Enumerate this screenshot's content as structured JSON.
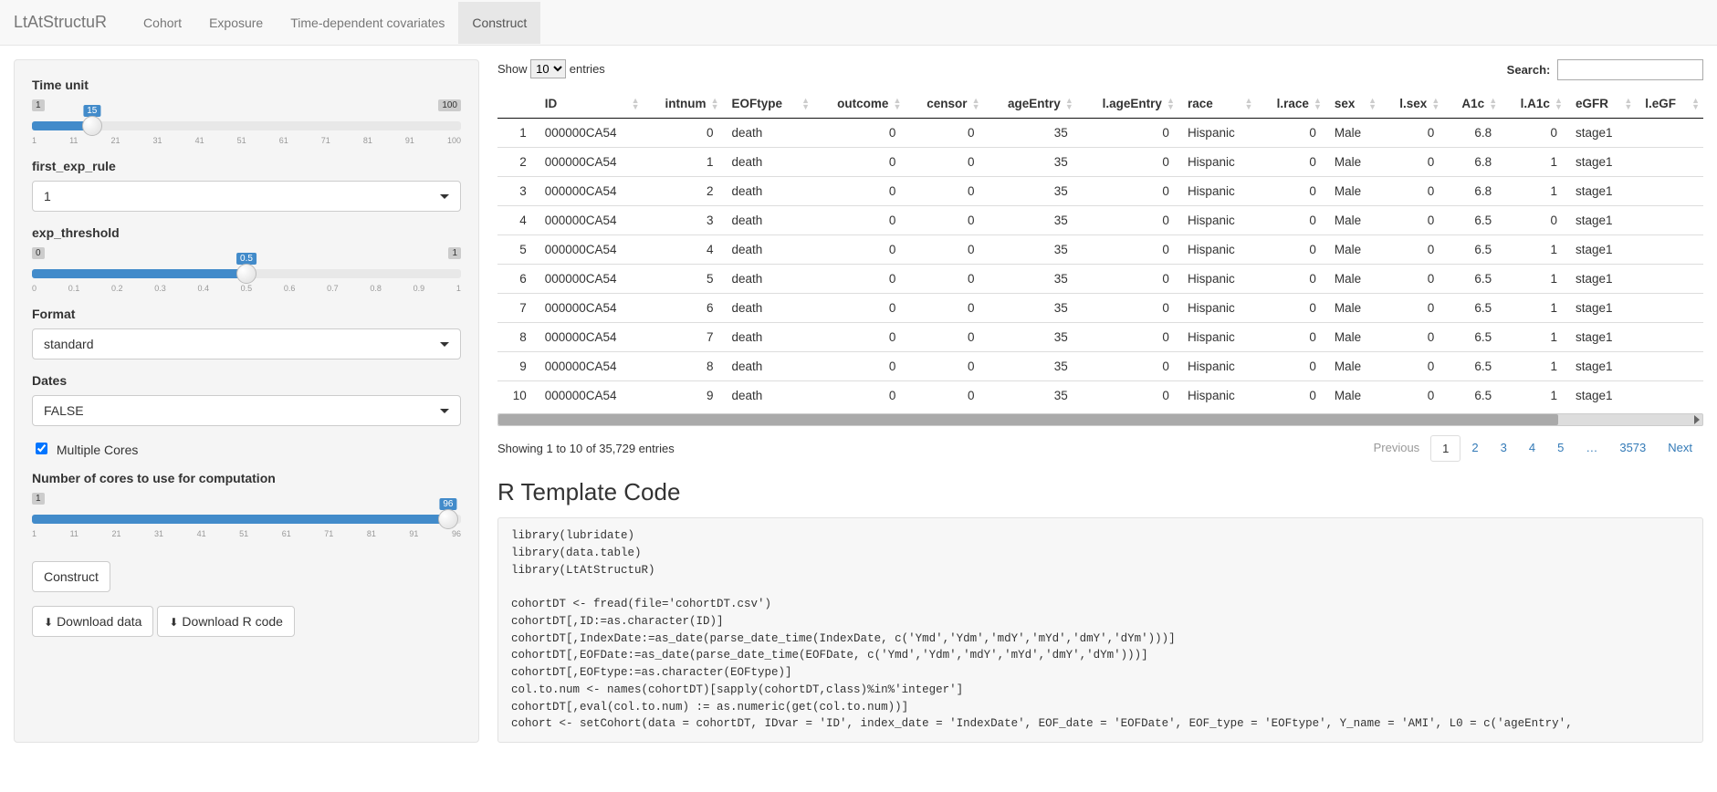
{
  "app": {
    "brand": "LtAtStructuR"
  },
  "nav": {
    "items": [
      {
        "label": "Cohort",
        "active": false
      },
      {
        "label": "Exposure",
        "active": false
      },
      {
        "label": "Time-dependent covariates",
        "active": false
      },
      {
        "label": "Construct",
        "active": true
      }
    ]
  },
  "sidebar": {
    "time_unit": {
      "label": "Time unit",
      "min": "1",
      "max": "100",
      "value": "15",
      "pct": 14,
      "ticks": [
        "1",
        "11",
        "21",
        "31",
        "41",
        "51",
        "61",
        "71",
        "81",
        "91",
        "100"
      ]
    },
    "first_exp_rule": {
      "label": "first_exp_rule",
      "value": "1"
    },
    "exp_threshold": {
      "label": "exp_threshold",
      "min": "0",
      "max": "1",
      "value": "0.5",
      "pct": 50,
      "ticks": [
        "0",
        "0.1",
        "0.2",
        "0.3",
        "0.4",
        "0.5",
        "0.6",
        "0.7",
        "0.8",
        "0.9",
        "1"
      ]
    },
    "format": {
      "label": "Format",
      "value": "standard"
    },
    "dates": {
      "label": "Dates",
      "value": "FALSE"
    },
    "multiple_cores": {
      "label": "Multiple Cores",
      "checked": true
    },
    "num_cores": {
      "label": "Number of cores to use for computation",
      "min": "1",
      "max_hidden": "96",
      "value": "96",
      "pct": 97,
      "ticks": [
        "1",
        "11",
        "21",
        "31",
        "41",
        "51",
        "61",
        "71",
        "81",
        "91",
        "96"
      ]
    },
    "construct_btn": "Construct",
    "download_data_btn": "Download data",
    "download_r_btn": "Download R code"
  },
  "datatable": {
    "show_label_pre": "Show",
    "show_label_post": "entries",
    "length_value": "10",
    "search_label": "Search:",
    "search_value": "",
    "columns": [
      {
        "key": "rownum",
        "label": ""
      },
      {
        "key": "ID",
        "label": "ID"
      },
      {
        "key": "intnum",
        "label": "intnum",
        "num": true
      },
      {
        "key": "EOFtype",
        "label": "EOFtype"
      },
      {
        "key": "outcome",
        "label": "outcome",
        "num": true
      },
      {
        "key": "censor",
        "label": "censor",
        "num": true
      },
      {
        "key": "ageEntry",
        "label": "ageEntry",
        "num": true
      },
      {
        "key": "l.ageEntry",
        "label": "l.ageEntry",
        "num": true
      },
      {
        "key": "race",
        "label": "race"
      },
      {
        "key": "l.race",
        "label": "l.race",
        "num": true
      },
      {
        "key": "sex",
        "label": "sex"
      },
      {
        "key": "l.sex",
        "label": "l.sex",
        "num": true
      },
      {
        "key": "A1c",
        "label": "A1c",
        "num": true
      },
      {
        "key": "l.A1c",
        "label": "l.A1c",
        "num": true
      },
      {
        "key": "eGFR",
        "label": "eGFR"
      },
      {
        "key": "l.eGFR",
        "label": "l.eGF"
      }
    ],
    "rows": [
      {
        "rownum": "1",
        "ID": "000000CA54",
        "intnum": "0",
        "EOFtype": "death",
        "outcome": "0",
        "censor": "0",
        "ageEntry": "35",
        "l.ageEntry": "0",
        "race": "Hispanic",
        "l.race": "0",
        "sex": "Male",
        "l.sex": "0",
        "A1c": "6.8",
        "l.A1c": "0",
        "eGFR": "stage1"
      },
      {
        "rownum": "2",
        "ID": "000000CA54",
        "intnum": "1",
        "EOFtype": "death",
        "outcome": "0",
        "censor": "0",
        "ageEntry": "35",
        "l.ageEntry": "0",
        "race": "Hispanic",
        "l.race": "0",
        "sex": "Male",
        "l.sex": "0",
        "A1c": "6.8",
        "l.A1c": "1",
        "eGFR": "stage1"
      },
      {
        "rownum": "3",
        "ID": "000000CA54",
        "intnum": "2",
        "EOFtype": "death",
        "outcome": "0",
        "censor": "0",
        "ageEntry": "35",
        "l.ageEntry": "0",
        "race": "Hispanic",
        "l.race": "0",
        "sex": "Male",
        "l.sex": "0",
        "A1c": "6.8",
        "l.A1c": "1",
        "eGFR": "stage1"
      },
      {
        "rownum": "4",
        "ID": "000000CA54",
        "intnum": "3",
        "EOFtype": "death",
        "outcome": "0",
        "censor": "0",
        "ageEntry": "35",
        "l.ageEntry": "0",
        "race": "Hispanic",
        "l.race": "0",
        "sex": "Male",
        "l.sex": "0",
        "A1c": "6.5",
        "l.A1c": "0",
        "eGFR": "stage1"
      },
      {
        "rownum": "5",
        "ID": "000000CA54",
        "intnum": "4",
        "EOFtype": "death",
        "outcome": "0",
        "censor": "0",
        "ageEntry": "35",
        "l.ageEntry": "0",
        "race": "Hispanic",
        "l.race": "0",
        "sex": "Male",
        "l.sex": "0",
        "A1c": "6.5",
        "l.A1c": "1",
        "eGFR": "stage1"
      },
      {
        "rownum": "6",
        "ID": "000000CA54",
        "intnum": "5",
        "EOFtype": "death",
        "outcome": "0",
        "censor": "0",
        "ageEntry": "35",
        "l.ageEntry": "0",
        "race": "Hispanic",
        "l.race": "0",
        "sex": "Male",
        "l.sex": "0",
        "A1c": "6.5",
        "l.A1c": "1",
        "eGFR": "stage1"
      },
      {
        "rownum": "7",
        "ID": "000000CA54",
        "intnum": "6",
        "EOFtype": "death",
        "outcome": "0",
        "censor": "0",
        "ageEntry": "35",
        "l.ageEntry": "0",
        "race": "Hispanic",
        "l.race": "0",
        "sex": "Male",
        "l.sex": "0",
        "A1c": "6.5",
        "l.A1c": "1",
        "eGFR": "stage1"
      },
      {
        "rownum": "8",
        "ID": "000000CA54",
        "intnum": "7",
        "EOFtype": "death",
        "outcome": "0",
        "censor": "0",
        "ageEntry": "35",
        "l.ageEntry": "0",
        "race": "Hispanic",
        "l.race": "0",
        "sex": "Male",
        "l.sex": "0",
        "A1c": "6.5",
        "l.A1c": "1",
        "eGFR": "stage1"
      },
      {
        "rownum": "9",
        "ID": "000000CA54",
        "intnum": "8",
        "EOFtype": "death",
        "outcome": "0",
        "censor": "0",
        "ageEntry": "35",
        "l.ageEntry": "0",
        "race": "Hispanic",
        "l.race": "0",
        "sex": "Male",
        "l.sex": "0",
        "A1c": "6.5",
        "l.A1c": "1",
        "eGFR": "stage1"
      },
      {
        "rownum": "10",
        "ID": "000000CA54",
        "intnum": "9",
        "EOFtype": "death",
        "outcome": "0",
        "censor": "0",
        "ageEntry": "35",
        "l.ageEntry": "0",
        "race": "Hispanic",
        "l.race": "0",
        "sex": "Male",
        "l.sex": "0",
        "A1c": "6.5",
        "l.A1c": "1",
        "eGFR": "stage1"
      }
    ],
    "info": "Showing 1 to 10 of 35,729 entries",
    "pagination": {
      "prev": "Previous",
      "pages": [
        "1",
        "2",
        "3",
        "4",
        "5",
        "…",
        "3573"
      ],
      "next": "Next",
      "active": "1"
    }
  },
  "code": {
    "heading": "R Template Code",
    "text": "library(lubridate)\nlibrary(data.table)\nlibrary(LtAtStructuR)\n\ncohortDT <- fread(file='cohortDT.csv')\ncohortDT[,ID:=as.character(ID)]\ncohortDT[,IndexDate:=as_date(parse_date_time(IndexDate, c('Ymd','Ydm','mdY','mYd','dmY','dYm')))]\ncohortDT[,EOFDate:=as_date(parse_date_time(EOFDate, c('Ymd','Ydm','mdY','mYd','dmY','dYm')))]\ncohortDT[,EOFtype:=as.character(EOFtype)]\ncol.to.num <- names(cohortDT)[sapply(cohortDT,class)%in%'integer']\ncohortDT[,eval(col.to.num) := as.numeric(get(col.to.num))]\ncohort <- setCohort(data = cohortDT, IDvar = 'ID', index_date = 'IndexDate', EOF_date = 'EOFDate', EOF_type = 'EOFtype', Y_name = 'AMI', L0 = c('ageEntry',"
  }
}
